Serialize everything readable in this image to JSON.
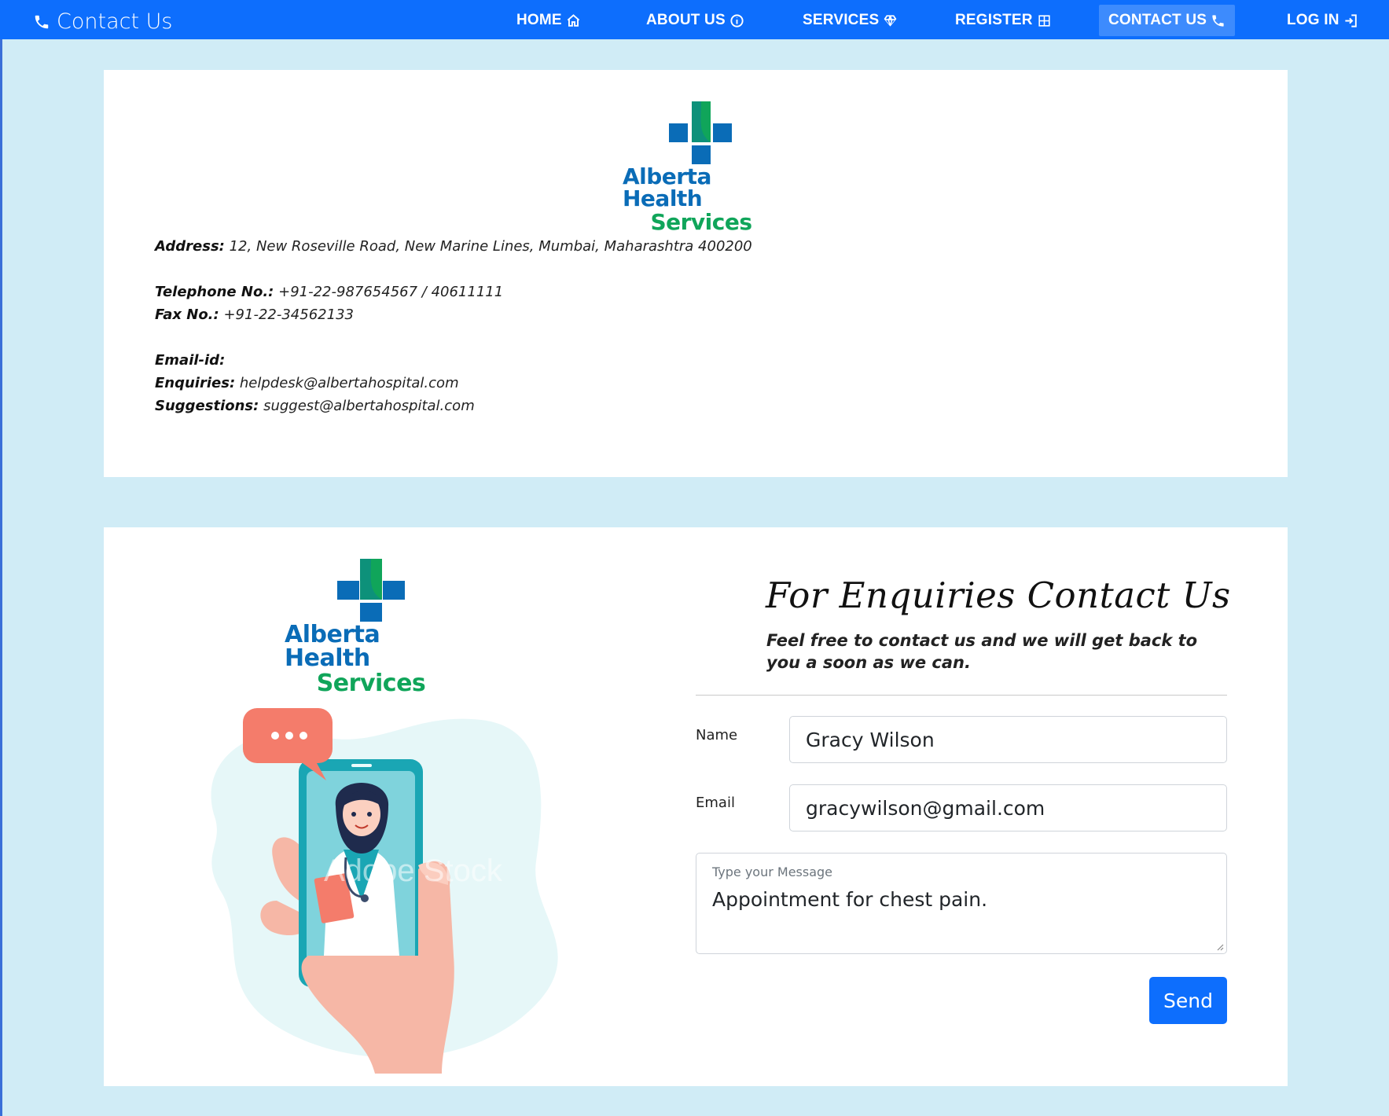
{
  "navbar": {
    "brand": "Contact Us",
    "brand_icon": "phone-icon",
    "items": [
      {
        "label": "HOME",
        "icon": "home-icon"
      },
      {
        "label": "ABOUT US",
        "icon": "info-icon"
      },
      {
        "label": "SERVICES",
        "icon": "gem-icon"
      },
      {
        "label": "REGISTER",
        "icon": "grid-icon"
      },
      {
        "label": "CONTACT US",
        "icon": "phone-icon",
        "active": true
      },
      {
        "label": "LOG IN",
        "icon": "login-icon"
      }
    ],
    "bg_color": "#0d6efd",
    "active_color": "#3d8bfd"
  },
  "logo": {
    "line1": "Alberta Health",
    "line2": "Services",
    "blue": "#0a6cb7",
    "green": "#10a55a"
  },
  "contact_info": {
    "address_label": "Address:",
    "address_value": "12, New Roseville Road, New Marine Lines, Mumbai, Maharashtra 400200",
    "telephone_label": "Telephone No.:",
    "telephone_value": "+91-22-987654567 / 40611111",
    "fax_label": "Fax No.:",
    "fax_value": "+91-22-34562133",
    "email_heading": "Email-id:",
    "enquiries_label": "Enquiries:",
    "enquiries_value": "helpdesk@albertahospital.com",
    "suggestions_label": "Suggestions:",
    "suggestions_value": "suggest@albertahospital.com"
  },
  "illustration": {
    "watermark": "Adobe Stock"
  },
  "form": {
    "title": "For Enquiries Contact Us",
    "subtitle": "Feel free to contact us and we will get back to you a soon as we can.",
    "name_label": "Name",
    "name_value": "Gracy Wilson",
    "email_label": "Email",
    "email_value": "gracywilson@gmail.com",
    "message_label": "Type your Message",
    "message_value": "Appointment for chest pain.",
    "send_label": "Send"
  },
  "page_bg": "#d0ecf6"
}
